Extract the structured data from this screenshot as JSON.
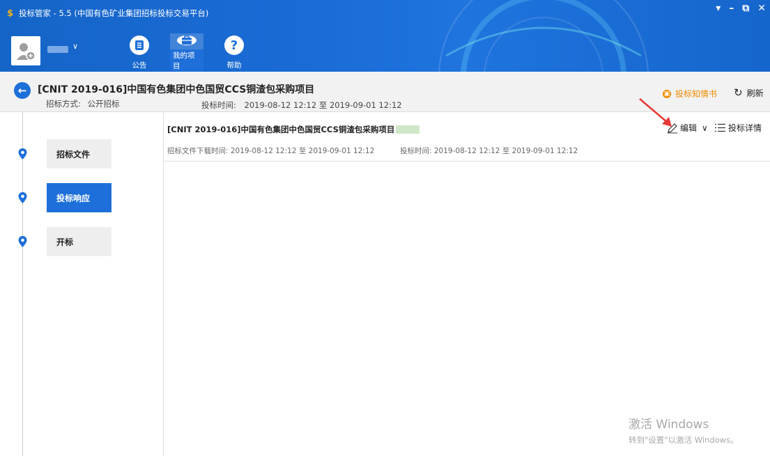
{
  "app": {
    "title": "投标管家 - 5.5 (中国有色矿业集团招标投标交易平台)",
    "logo_char": "$"
  },
  "window_controls": [
    "▾",
    "–",
    "⧉",
    "✕"
  ],
  "nav": [
    {
      "label": "公告",
      "icon": "document-list-icon",
      "active": false
    },
    {
      "label": "我的项目",
      "icon": "briefcase-icon",
      "active": true
    },
    {
      "label": "帮助",
      "icon": "question-icon",
      "active": false
    }
  ],
  "user": {
    "dropdown": "∨"
  },
  "project": {
    "title": "[CNIT 2019-016]中国有色集团中色国贸CCS铜渣包采购项目",
    "method_label": "招标方式:",
    "method_value": "公开招标",
    "bid_time_label": "投标时间:",
    "bid_time_value": "2019-08-12 12:12 至 2019-09-01 12:12",
    "notice_link": "投标知情书",
    "refresh": "刷新"
  },
  "steps": [
    {
      "label": "招标文件",
      "active": false
    },
    {
      "label": "投标响应",
      "active": true
    },
    {
      "label": "开标",
      "active": false
    }
  ],
  "item": {
    "title": "[CNIT 2019-016]中国有色集团中色国贸CCS铜渣包采购项目",
    "download_time": "招标文件下载时间: 2019-08-12 12:12 至 2019-09-01 12:12",
    "bid_time": "投标时间: 2019-08-12 12:12 至 2019-09-01 12:12",
    "edit": "编辑",
    "details": "投标详情"
  },
  "watermark": {
    "line1": "激活 Windows",
    "line2": "转到\"设置\"以激活 Windows。"
  },
  "colors": {
    "brand": "#1e6fd9",
    "accent": "#f08c00",
    "annotation": "#e53935"
  }
}
